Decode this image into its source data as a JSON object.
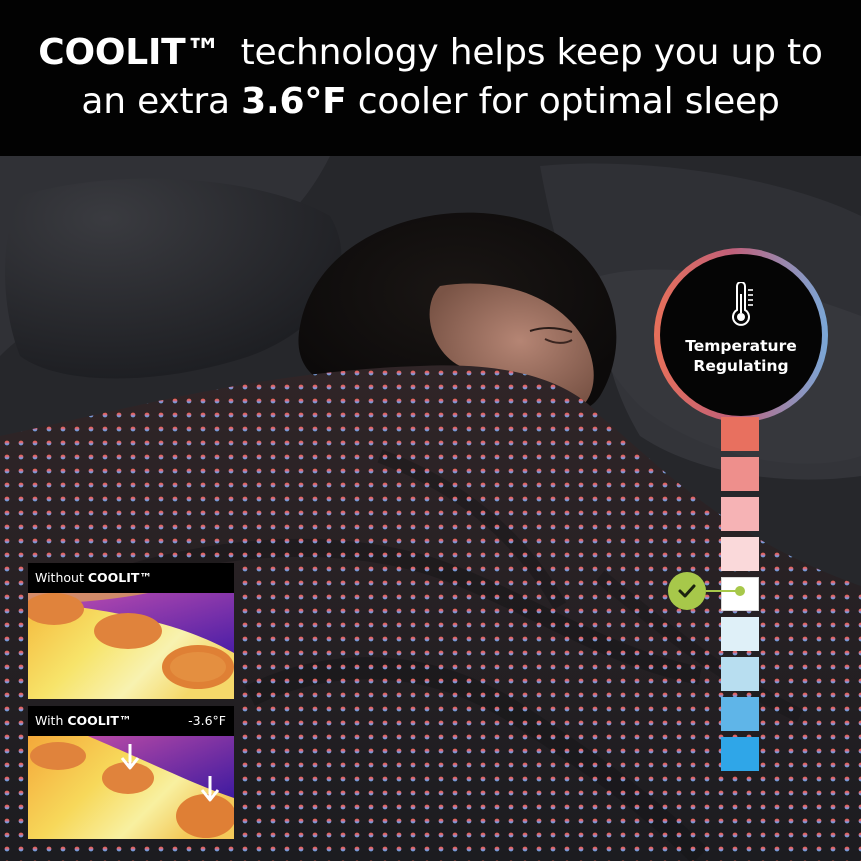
{
  "headline": {
    "brand": "COOLIT™",
    "line1_rest": "technology helps keep you up to",
    "line2_pre": "an extra",
    "line2_bold": "3.6°F",
    "line2_post": "cooler for optimal sleep"
  },
  "badge": {
    "icon": "thermometer-icon",
    "line1": "Temperature",
    "line2": "Regulating"
  },
  "scale": {
    "colors": [
      "#e8705f",
      "#ee8f8c",
      "#f6b3b5",
      "#fad9da",
      "#ffffff",
      "#dff0f8",
      "#b8def0",
      "#5fb5e8",
      "#2fa6e8"
    ],
    "selected_index": 4,
    "check_icon": "check-icon",
    "check_color": "#a7c84a"
  },
  "thermal": {
    "without": {
      "prefix": "Without",
      "brand": "COOLIT™"
    },
    "with": {
      "prefix": "With",
      "brand": "COOLIT™",
      "delta": "-3.6°F"
    },
    "arrow_icon": "down-arrow-icon"
  }
}
